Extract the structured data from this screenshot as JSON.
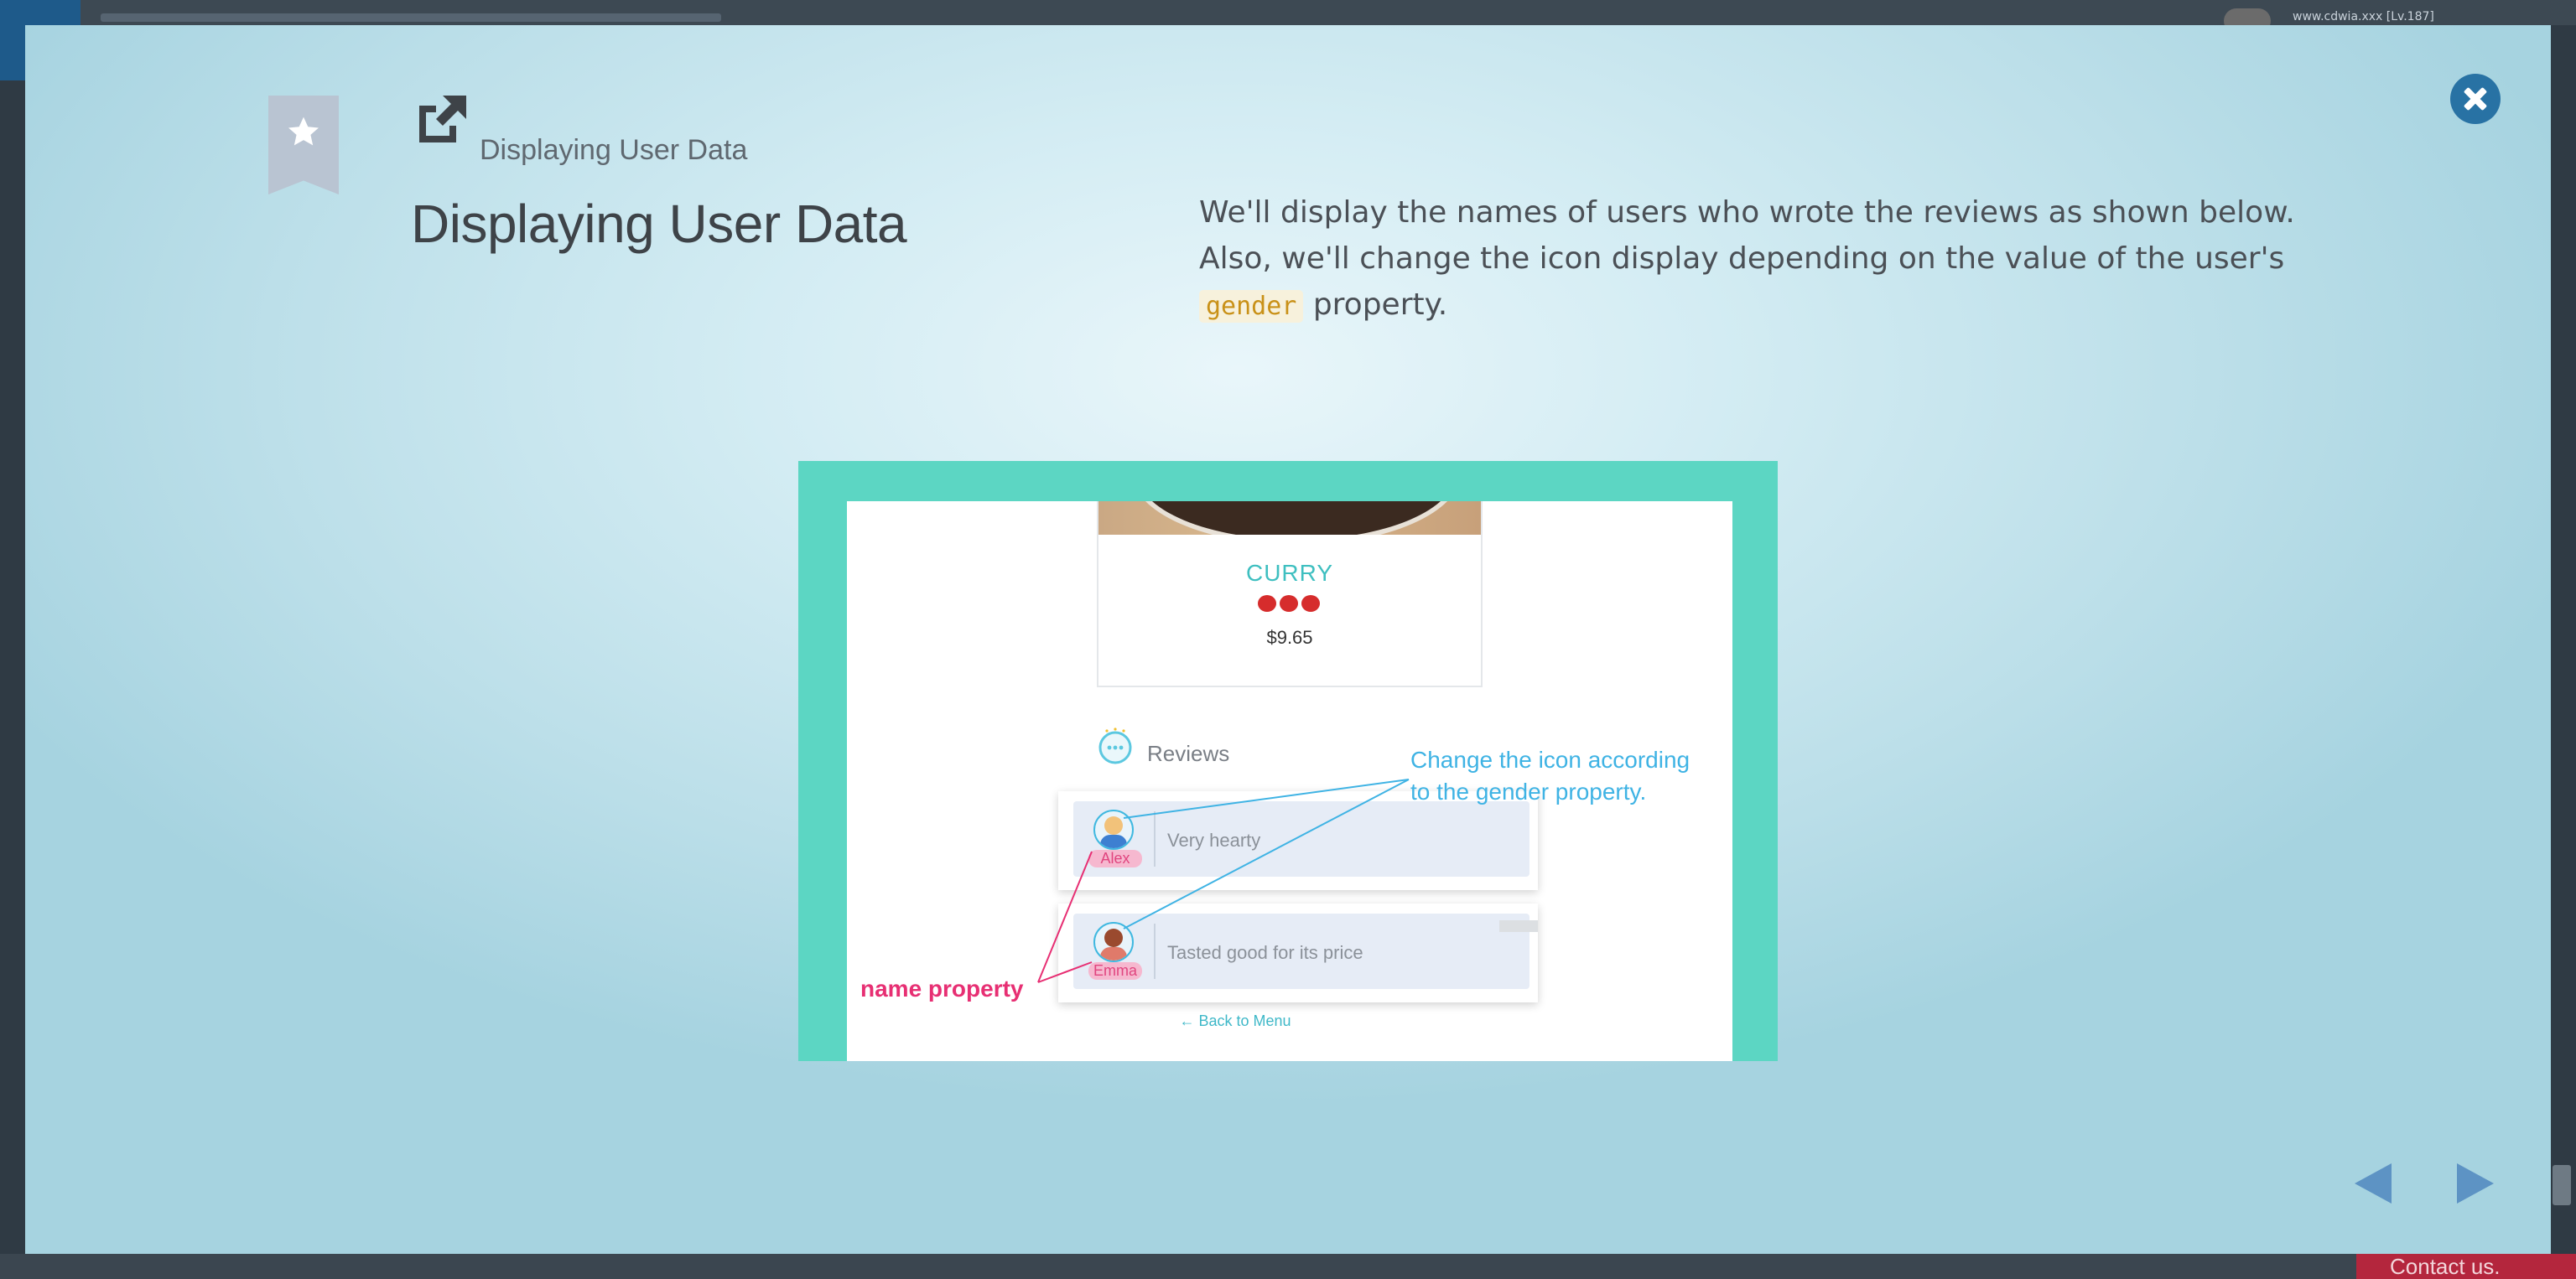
{
  "background": {
    "user_text": "www.cdwia.xxx [Lv.187]",
    "contact_label": "Contact us."
  },
  "modal": {
    "breadcrumb": "Displaying User Data",
    "title": "Displaying User Data",
    "description_before": "We'll display the names of users who wrote the reviews as shown below. Also, we'll change the icon display depending on the value of the user's ",
    "description_code": "gender",
    "description_after": " property.",
    "icons": {
      "bookmark": "bookmark-star-icon",
      "external": "external-link-icon",
      "close": "close-icon",
      "prev": "triangle-left-icon",
      "next": "triangle-right-icon"
    }
  },
  "figure": {
    "food_name": "CURRY",
    "spice_level": 3,
    "price": "$9.65",
    "reviews_label": "Reviews",
    "reviews": [
      {
        "name": "Alex",
        "text": "Very hearty",
        "gender": "male"
      },
      {
        "name": "Emma",
        "text": "Tasted good for its price",
        "gender": "female"
      }
    ],
    "annotation_icon": "Change the icon according to the gender property.",
    "annotation_icon_line1": "Change the icon according",
    "annotation_icon_line2": "to the gender property.",
    "annotation_name": "name property",
    "back_link": "← Back to Menu"
  },
  "colors": {
    "accent": "#2872a4",
    "teal_frame": "#5cd6c3",
    "annotation_blue": "#3fb3e4",
    "annotation_pink": "#e72f73"
  }
}
